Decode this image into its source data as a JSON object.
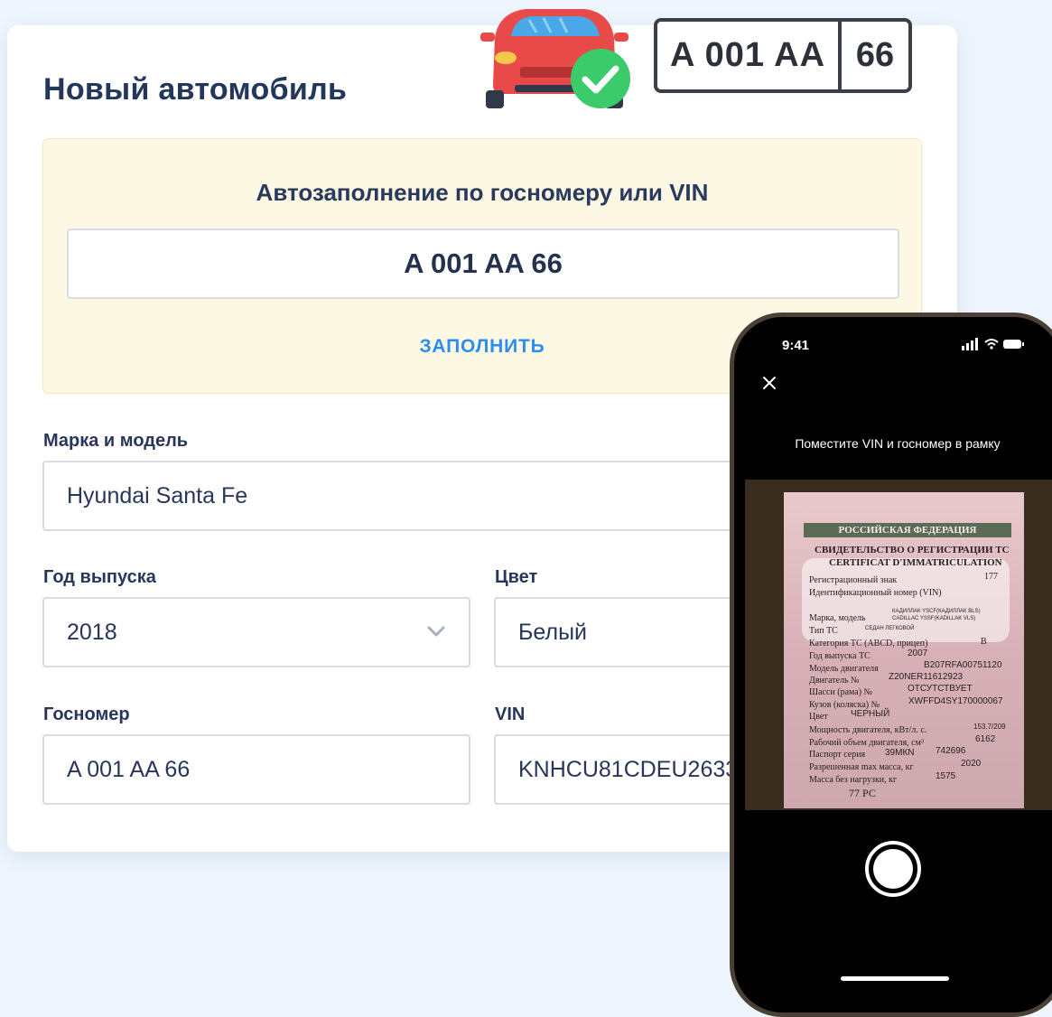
{
  "card": {
    "title": "Новый автомобиль"
  },
  "plate": {
    "main": "A 001 AA",
    "region": "66"
  },
  "autofill": {
    "title": "Автозаполнение по госномеру или VIN",
    "value": "A 001 AA 66",
    "button": "ЗАПОЛНИТЬ"
  },
  "form": {
    "brand": {
      "label": "Марка и модель",
      "value": "Hyundai Santa Fe"
    },
    "year": {
      "label": "Год выпуска",
      "value": "2018"
    },
    "color": {
      "label": "Цвет",
      "value": "Белый"
    },
    "plate": {
      "label": "Госномер",
      "value": "A 001 AA 66"
    },
    "vin": {
      "label": "VIN",
      "value": "KNHCU81CDEU2633"
    }
  },
  "phone": {
    "time": "9:41",
    "hint": "Поместите VIN и госномер в рамку",
    "document": {
      "header": "РОССИЙСКАЯ ФЕДЕРАЦИЯ",
      "lines": [
        "СВИДЕТЕЛЬСТВО О РЕГИСТРАЦИИ ТС",
        "CERTIFICAT D'IMMATRICULATION",
        "Регистрационный знак",
        "177",
        "Идентификационный номер (VIN)",
        "Марка, модель",
        "КАДИЛЛАК YSCF(КАДИЛЛАК BLS)",
        "CADILLAC YSSF(KADILLAK VLS)",
        "Тип ТС",
        "СЕДАН ЛЕГКОВОЙ",
        "Категория ТС (ABCD, прицеп)",
        "B",
        "Год выпуска ТС",
        "2007",
        "Модель двигателя",
        "B207RFA00751120",
        "Двигатель №",
        "Z20NER11612923",
        "Шасси (рама) №",
        "ОТСУТСТВУЕТ",
        "Кузов (коляска) №",
        "XWFFD4SY170000067",
        "Цвет",
        "ЧЕРНЫЙ",
        "Мощность двигателя, кВт/л. с.",
        "153.7/209",
        "Рабочий объем двигателя, см³",
        "6162",
        "Паспорт серия",
        "39МКN",
        "742696",
        "Разрешенная max масса, кг",
        "2020",
        "Масса без нагрузки, кг",
        "1575",
        "77 РС"
      ]
    }
  },
  "colors": {
    "accent": "#2b8ef0",
    "title": "#23365c",
    "autofill_bg": "#fdf8e3",
    "page_bg": "#eef5fd"
  },
  "icons": {
    "car": "car-icon",
    "check": "check-circle-icon",
    "chevron": "chevron-down-icon",
    "close": "close-icon",
    "shutter": "shutter-button"
  }
}
